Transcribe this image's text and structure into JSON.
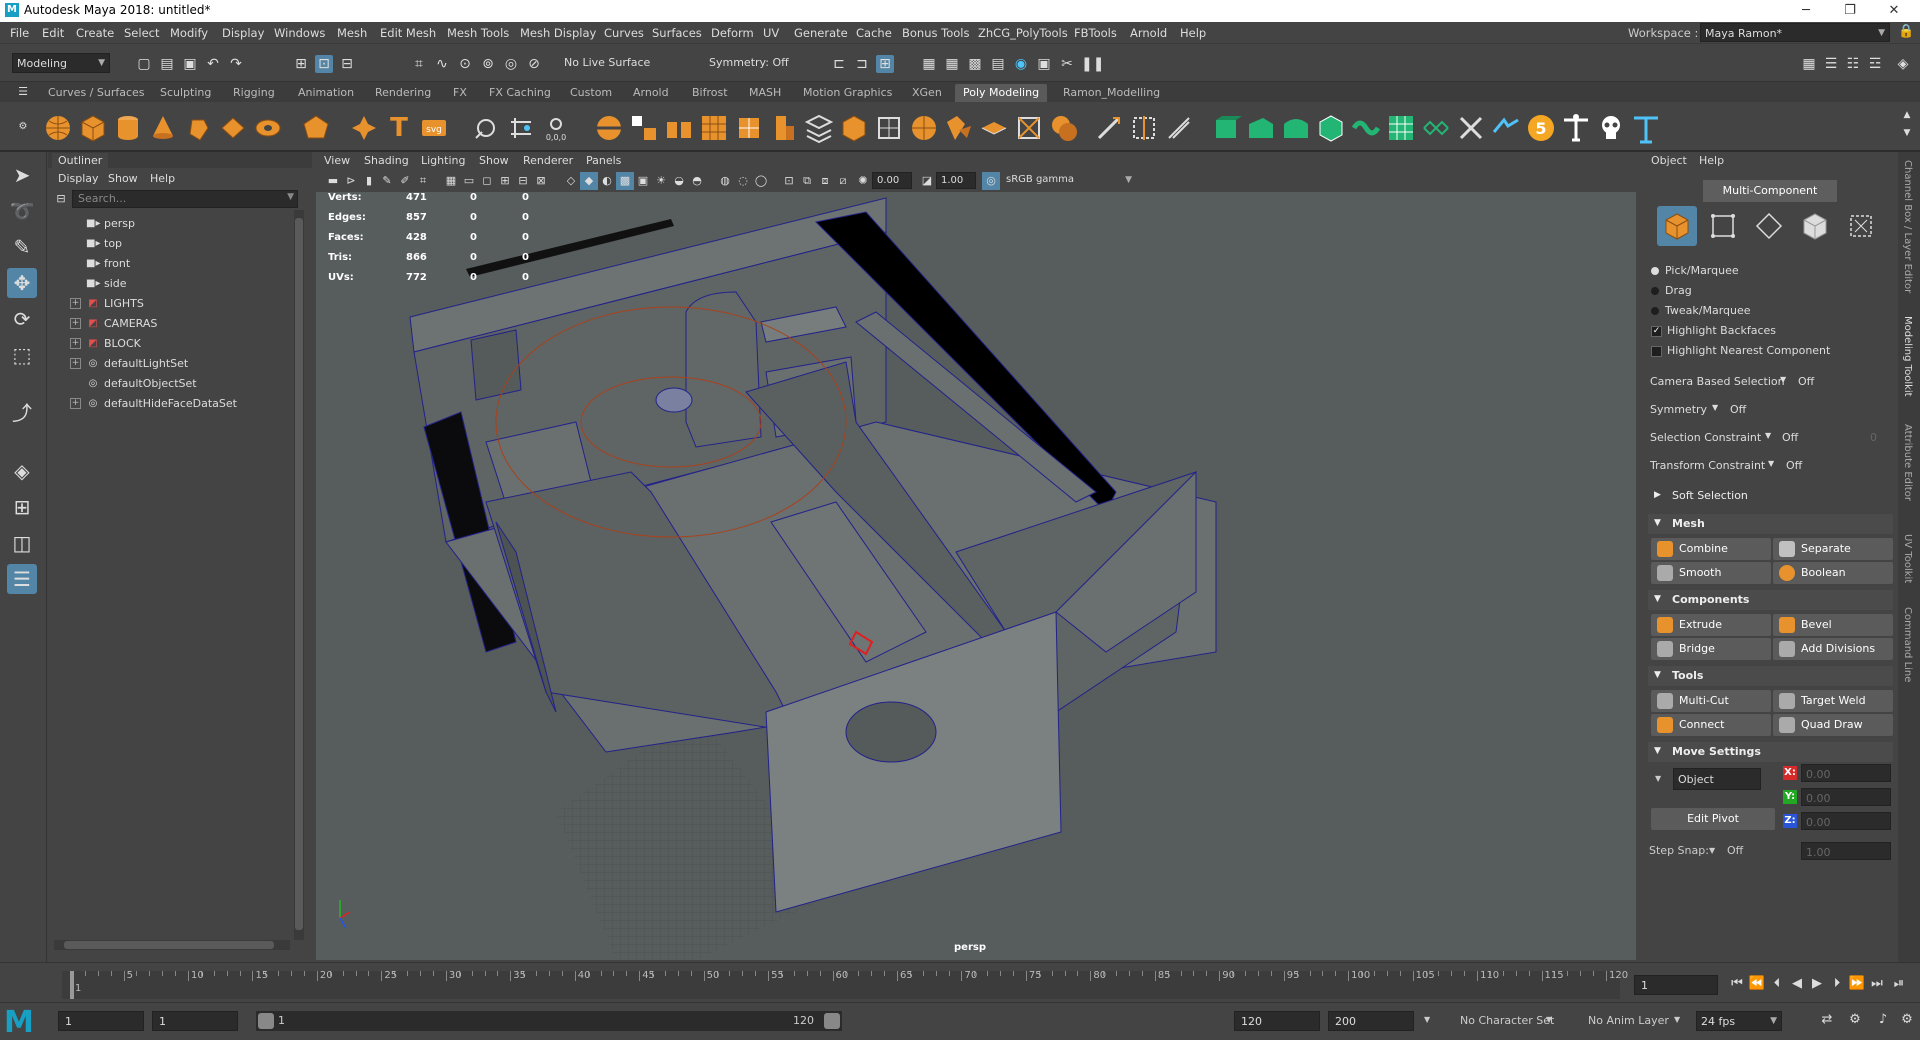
{
  "window": {
    "title": "Autodesk Maya 2018: untitled*",
    "logo": "M",
    "minimize": "─",
    "maximize": "❐",
    "close": "✕"
  },
  "menubar": [
    "File",
    "Edit",
    "Create",
    "Select",
    "Modify",
    "Display",
    "Windows",
    "Mesh",
    "Edit Mesh",
    "Mesh Tools",
    "Mesh Display",
    "Curves",
    "Surfaces",
    "Deform",
    "UV",
    "Generate",
    "Cache",
    "Bonus Tools",
    "ZhCG_PolyTools",
    "FBTools",
    "Arnold",
    "Help"
  ],
  "workspace": {
    "label": "Workspace :",
    "value": "Maya Ramon*"
  },
  "statusline": {
    "menuset": "Modeling",
    "live_surface": "No Live Surface",
    "symmetry": "Symmetry: Off"
  },
  "shelf_tabs": [
    "Curves / Surfaces",
    "Sculpting",
    "Rigging",
    "Animation",
    "Rendering",
    "FX",
    "FX Caching",
    "Custom",
    "Arnold",
    "Bifrost",
    "MASH",
    "Motion Graphics",
    "XGen",
    "Poly Modeling",
    "Ramon_Modelling"
  ],
  "shelf_active_tab": "Poly Modeling",
  "shelf_badge": "5",
  "outliner": {
    "title": "Outliner",
    "menu": [
      "Display",
      "Show",
      "Help"
    ],
    "search_placeholder": "Search...",
    "items": [
      {
        "label": "persp",
        "icon": "camera-icon",
        "expand": ""
      },
      {
        "label": "top",
        "icon": "camera-icon",
        "expand": ""
      },
      {
        "label": "front",
        "icon": "camera-icon",
        "expand": ""
      },
      {
        "label": "side",
        "icon": "camera-icon",
        "expand": ""
      },
      {
        "label": "LIGHTS",
        "icon": "group-icon",
        "expand": "+"
      },
      {
        "label": "CAMERAS",
        "icon": "group-icon",
        "expand": "+"
      },
      {
        "label": "BLOCK",
        "icon": "group-icon",
        "expand": "+"
      },
      {
        "label": "defaultLightSet",
        "icon": "set-icon",
        "expand": "+"
      },
      {
        "label": "defaultObjectSet",
        "icon": "set-icon",
        "expand": ""
      },
      {
        "label": "defaultHideFaceDataSet",
        "icon": "set-icon",
        "expand": "+"
      }
    ]
  },
  "viewport": {
    "menu": [
      "View",
      "Shading",
      "Lighting",
      "Show",
      "Renderer",
      "Panels"
    ],
    "exposure": "0.00",
    "gamma": "1.00",
    "colorspace": "sRGB gamma",
    "camera_label": "persp",
    "hud": [
      {
        "label": "Verts:",
        "v1": "471",
        "v2": "0",
        "v3": "0"
      },
      {
        "label": "Edges:",
        "v1": "857",
        "v2": "0",
        "v3": "0"
      },
      {
        "label": "Faces:",
        "v1": "428",
        "v2": "0",
        "v3": "0"
      },
      {
        "label": "Tris:",
        "v1": "866",
        "v2": "0",
        "v3": "0"
      },
      {
        "label": "UVs:",
        "v1": "772",
        "v2": "0",
        "v3": "0"
      }
    ]
  },
  "modeling_toolkit": {
    "tabs": [
      "Object",
      "Help"
    ],
    "mode": "Multi-Component",
    "options": {
      "pick": "Pick/Marquee",
      "drag": "Drag",
      "tweak": "Tweak/Marquee",
      "highlight_backfaces": "Highlight Backfaces",
      "highlight_nearest": "Highlight Nearest Component"
    },
    "rows": [
      {
        "label": "Camera Based Selection",
        "value": "Off",
        "extra": ""
      },
      {
        "label": "Symmetry",
        "value": "Off",
        "extra": ""
      },
      {
        "label": "Selection Constraint",
        "value": "Off",
        "extra": "0"
      },
      {
        "label": "Transform Constraint",
        "value": "Off",
        "extra": ""
      }
    ],
    "soft_selection": "Soft Selection",
    "sections": {
      "mesh": {
        "title": "Mesh",
        "buttons": [
          "Combine",
          "Separate",
          "Smooth",
          "Boolean"
        ]
      },
      "components": {
        "title": "Components",
        "buttons": [
          "Extrude",
          "Bevel",
          "Bridge",
          "Add Divisions"
        ]
      },
      "tools": {
        "title": "Tools",
        "buttons": [
          "Multi-Cut",
          "Target Weld",
          "Connect",
          "Quad Draw"
        ]
      }
    },
    "move_settings": {
      "title": "Move Settings",
      "space": "Object",
      "x": "0.00",
      "y": "0.00",
      "z": "0.00",
      "edit_pivot": "Edit Pivot",
      "step_snap_label": "Step Snap:",
      "step_snap_value": "Off",
      "step_snap_num": "1.00"
    }
  },
  "side_tabs": [
    "Channel Box / Layer Editor",
    "Modeling Toolkit",
    "Attribute Editor",
    "UV Toolkit",
    "Command Line"
  ],
  "timeslider": {
    "ticks": [
      "1",
      "5",
      "10",
      "15",
      "20",
      "25",
      "30",
      "35",
      "40",
      "45",
      "50",
      "55",
      "60",
      "65",
      "70",
      "75",
      "80",
      "85",
      "90",
      "95",
      "100",
      "105",
      "110",
      "115",
      "120"
    ],
    "current": "1"
  },
  "rangeslider": {
    "start": "1",
    "anim_start": "1",
    "range_start": "1",
    "range_end": "120",
    "end": "120",
    "anim_end": "200",
    "character": "No Character Set",
    "anim_layer": "No Anim Layer",
    "fps": "24 fps"
  },
  "colors": {
    "accent": "#5285a6",
    "orange": "#e8922e",
    "maya_blue": "#18a0c4"
  }
}
